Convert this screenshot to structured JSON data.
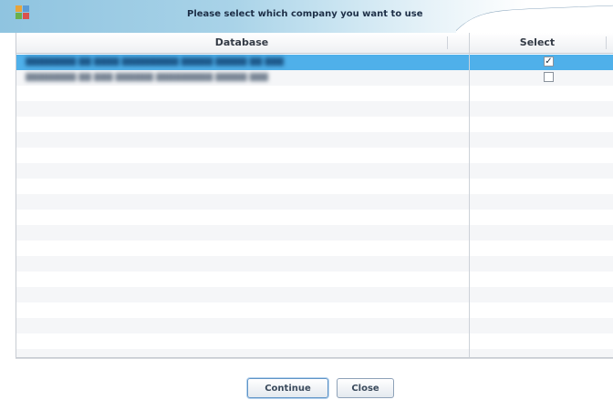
{
  "window": {
    "title": "Please select which company you want to use"
  },
  "grid": {
    "columns": {
      "database": "Database",
      "select": "Select"
    },
    "rows": [
      {
        "name": "████████ ██ ████ █████████ █████ █████ ██ ███",
        "selected": true,
        "checked": "✓"
      },
      {
        "name": "████████ ██ ███ ██████ █████████ █████ ███",
        "selected": false,
        "checked": ""
      },
      {
        "name": "",
        "selected": false,
        "checked": null
      },
      {
        "name": "",
        "selected": false,
        "checked": null
      },
      {
        "name": "",
        "selected": false,
        "checked": null
      },
      {
        "name": "",
        "selected": false,
        "checked": null
      },
      {
        "name": "",
        "selected": false,
        "checked": null
      },
      {
        "name": "",
        "selected": false,
        "checked": null
      },
      {
        "name": "",
        "selected": false,
        "checked": null
      },
      {
        "name": "",
        "selected": false,
        "checked": null
      },
      {
        "name": "",
        "selected": false,
        "checked": null
      },
      {
        "name": "",
        "selected": false,
        "checked": null
      },
      {
        "name": "",
        "selected": false,
        "checked": null
      },
      {
        "name": "",
        "selected": false,
        "checked": null
      },
      {
        "name": "",
        "selected": false,
        "checked": null
      },
      {
        "name": "",
        "selected": false,
        "checked": null
      },
      {
        "name": "",
        "selected": false,
        "checked": null
      },
      {
        "name": "",
        "selected": false,
        "checked": null
      },
      {
        "name": "",
        "selected": false,
        "checked": null
      },
      {
        "name": "",
        "selected": false,
        "checked": null
      }
    ]
  },
  "buttons": {
    "continue_label": "Continue",
    "close_label": "Close"
  },
  "icons": {
    "app": "app-icon",
    "checkbox_checked": "checkbox-checked-icon",
    "checkbox_unchecked": "checkbox-unchecked-icon"
  },
  "colors": {
    "selected_row": "#4fb0ea",
    "title_gradient": "#8fc4e0",
    "button_border": "#5f94c7"
  }
}
